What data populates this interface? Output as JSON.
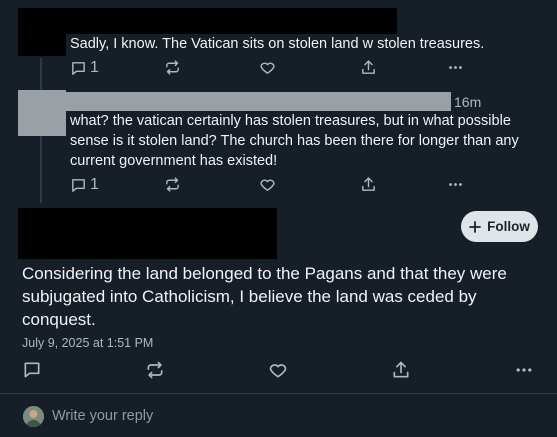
{
  "post1": {
    "text": "Sadly, I know. The Vatican sits on stolen land w stolen treasures.",
    "reply_count": "1"
  },
  "post2": {
    "time": "16m",
    "text": "what? the vatican certainly has stolen treasures, but in what possible sense is it stolen land? The church has been there for longer than any current government has existed!",
    "reply_count": "1"
  },
  "main_post": {
    "follow_label": "Follow",
    "text": "Considering the land belonged to the Pagans and that they were subjugated into Catholicism, I believe the land was ceded by conquest.",
    "date": "July 9, 2025 at 1:51 PM"
  },
  "reply_box": {
    "placeholder": "Write your reply"
  },
  "icons": [
    "comment-icon",
    "repost-icon",
    "like-icon",
    "share-icon",
    "more-icon",
    "plus-icon"
  ],
  "colors": {
    "background": "#161e27",
    "text": "#f1f3f5",
    "muted": "#aeb8c2",
    "follow_bg": "#dfe4e8"
  }
}
